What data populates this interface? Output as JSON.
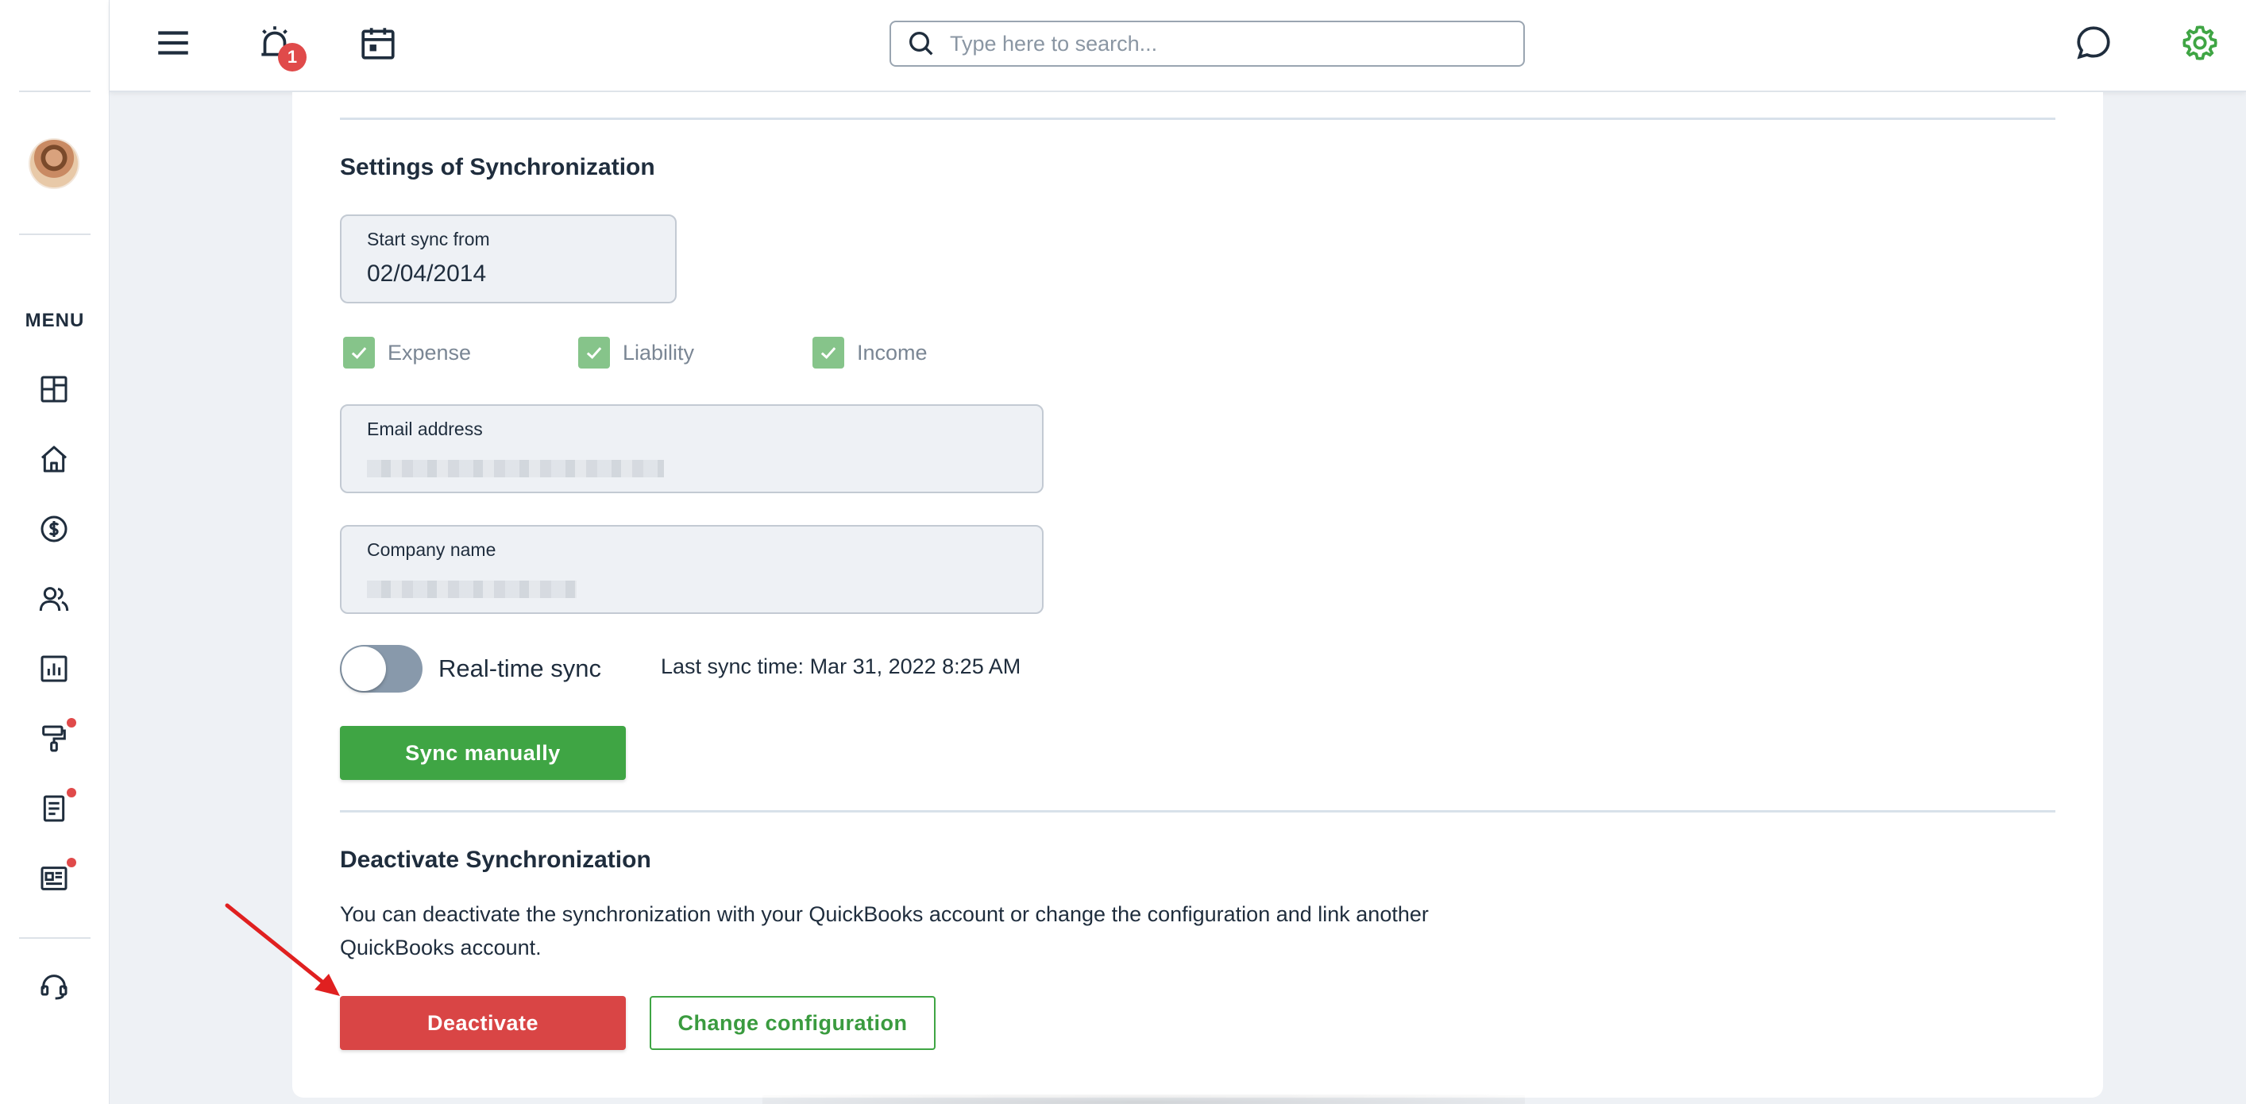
{
  "sidebar": {
    "menu_label": "MENU",
    "items": [
      {
        "name": "dashboard-icon"
      },
      {
        "name": "home-icon"
      },
      {
        "name": "dollar-circle-icon"
      },
      {
        "name": "users-icon"
      },
      {
        "name": "bar-chart-icon"
      },
      {
        "name": "paint-roller-icon",
        "dot": true
      },
      {
        "name": "document-icon",
        "dot": true
      },
      {
        "name": "newspaper-icon",
        "dot": true
      },
      {
        "name": "headset-icon"
      }
    ]
  },
  "topbar": {
    "notification_count": "1",
    "search_placeholder": "Type here to search..."
  },
  "sync_settings": {
    "title": "Settings of Synchronization",
    "start_sync_label": "Start sync from",
    "start_sync_value": "02/04/2014",
    "checkboxes": [
      {
        "label": "Expense",
        "checked": true
      },
      {
        "label": "Liability",
        "checked": true
      },
      {
        "label": "Income",
        "checked": true
      }
    ],
    "email_label": "Email address",
    "company_label": "Company name",
    "realtime_label": "Real-time sync",
    "realtime_on": false,
    "last_sync": "Last sync time: Mar 31, 2022 8:25 AM",
    "sync_button": "Sync manually"
  },
  "deactivate": {
    "title": "Deactivate Synchronization",
    "description": "You can deactivate the synchronization with your QuickBooks account or change the configuration and link another QuickBooks account.",
    "deactivate_button": "Deactivate",
    "change_button": "Change configuration"
  },
  "colors": {
    "green": "#3fa544",
    "red": "#d94545",
    "check_green": "#86c48a",
    "badge_red": "#e04a4a",
    "text_dark": "#1f2d3d"
  }
}
